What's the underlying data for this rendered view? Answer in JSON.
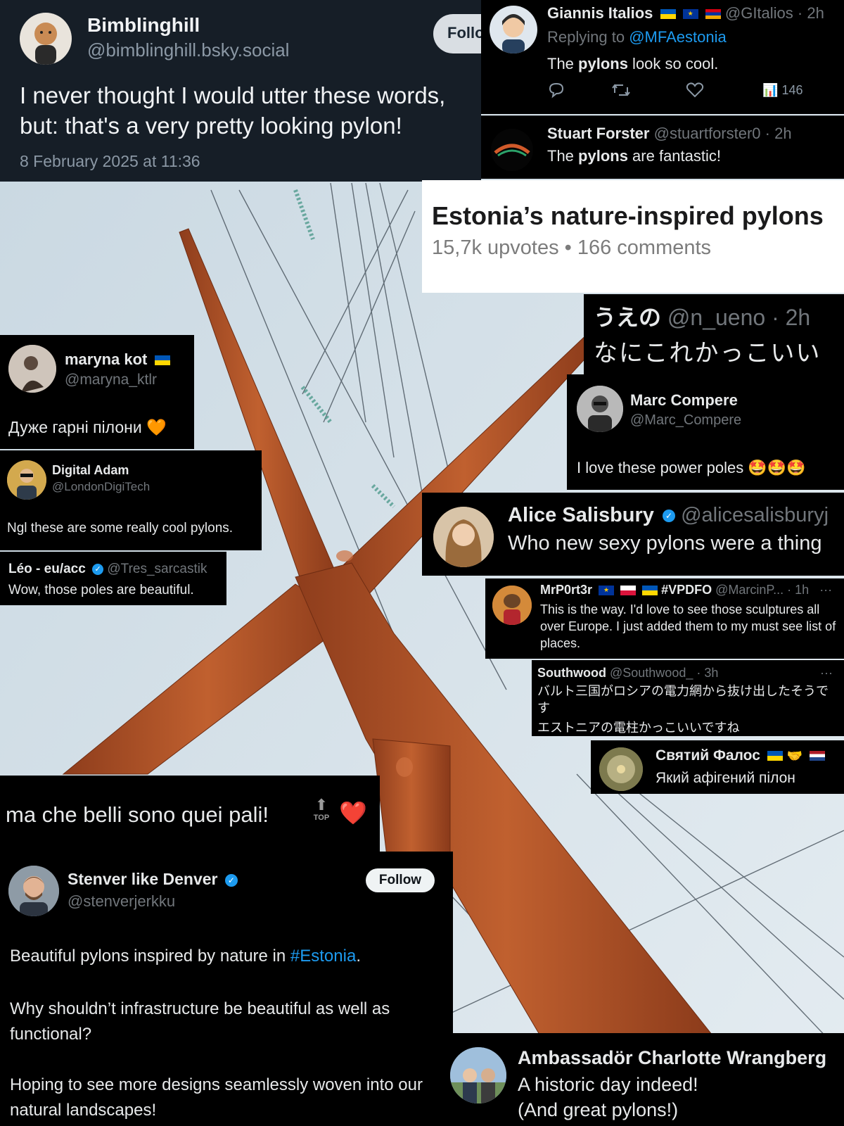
{
  "bluesky": {
    "name": "Bimblinghill",
    "handle": "@bimblinghill.bsky.social",
    "follow_label": "Follo",
    "text": "I never thought I would utter these words, but: that's a very pretty looking pylon!",
    "date": "8 February 2025 at 11:36"
  },
  "giannis": {
    "name": "Giannis Italios",
    "handle": "@GItalios",
    "time": "· 2h",
    "replying_prefix": "Replying to ",
    "replying_handle": "@MFAestonia",
    "text_pre": "The ",
    "text_bold": "pylons",
    "text_post": " look so cool.",
    "views": "146"
  },
  "stuart": {
    "name": "Stuart Forster",
    "handle": "@stuartforster0",
    "time": "· 2h",
    "text_pre": "The ",
    "text_bold": "pylons",
    "text_post": " are fantastic!"
  },
  "reddit": {
    "title": "Estonia’s nature-inspired pylons",
    "upvotes": "15,7k upvotes",
    "sep": "•",
    "comments": "166 comments"
  },
  "nueno": {
    "name": "うえの",
    "handle": "@n_ueno",
    "time": "· 2h",
    "text": "なにこれかっこいい"
  },
  "maryna": {
    "name": "maryna kot",
    "handle": "@maryna_ktlr",
    "text": "Дуже гарні пілони 🧡"
  },
  "marc": {
    "name": "Marc Compere",
    "handle": "@Marc_Compere",
    "text": "I love these power poles 🤩🤩🤩"
  },
  "adam": {
    "name": "Digital Adam",
    "handle": "@LondonDigiTech",
    "text": "Ngl these are some really cool pylons."
  },
  "alice": {
    "name": "Alice Salisbury",
    "handle": "@alicesalisburyj",
    "text": "Who new sexy pylons were a thing"
  },
  "leo": {
    "name": "Léo - eu/acc",
    "handle": "@Tres_sarcastik",
    "text": "Wow, those poles are beautiful."
  },
  "mrp": {
    "name": "MrP0rt3r",
    "tag": "#VPDFO",
    "handle": "@MarcinP...",
    "time": "· 1h",
    "more": "···",
    "text": "This is the way. I'd love to see those sculptures all over Europe. I just added them to my must see list of places."
  },
  "southwood": {
    "name": "Southwood",
    "handle": "@Southwood_",
    "time": "· 3h",
    "more": "···",
    "line1": "バルト三国がロシアの電力網から抜け出したそうです",
    "line2": "エストニアの電柱かっこいいですね"
  },
  "falos": {
    "name": "Святий Фалос",
    "text": "Який афігений пілон"
  },
  "italian": {
    "text": "ma che belli sono quei pali!",
    "top": "TOP",
    "heart": "❤️"
  },
  "stenver": {
    "name": "Stenver like Denver",
    "handle": "@stenverjerkku",
    "follow_label": "Follow",
    "p1_pre": "Beautiful pylons inspired by nature in ",
    "p1_tag": "#Estonia",
    "p1_post": ".",
    "p2": "Why shouldn’t infrastructure be beautiful as well as functional?",
    "p3": "Hoping to see more designs seamlessly woven into our natural landscapes!"
  },
  "charlotte": {
    "name": "Ambassadör Charlotte Wrangberg",
    "line1": "A historic day indeed!",
    "line2": "(And great pylons!)"
  },
  "colors": {
    "pylon": "#b4532a",
    "sky": "#d3e0e8",
    "link": "#1d9bf0",
    "navy": "#161e27"
  }
}
